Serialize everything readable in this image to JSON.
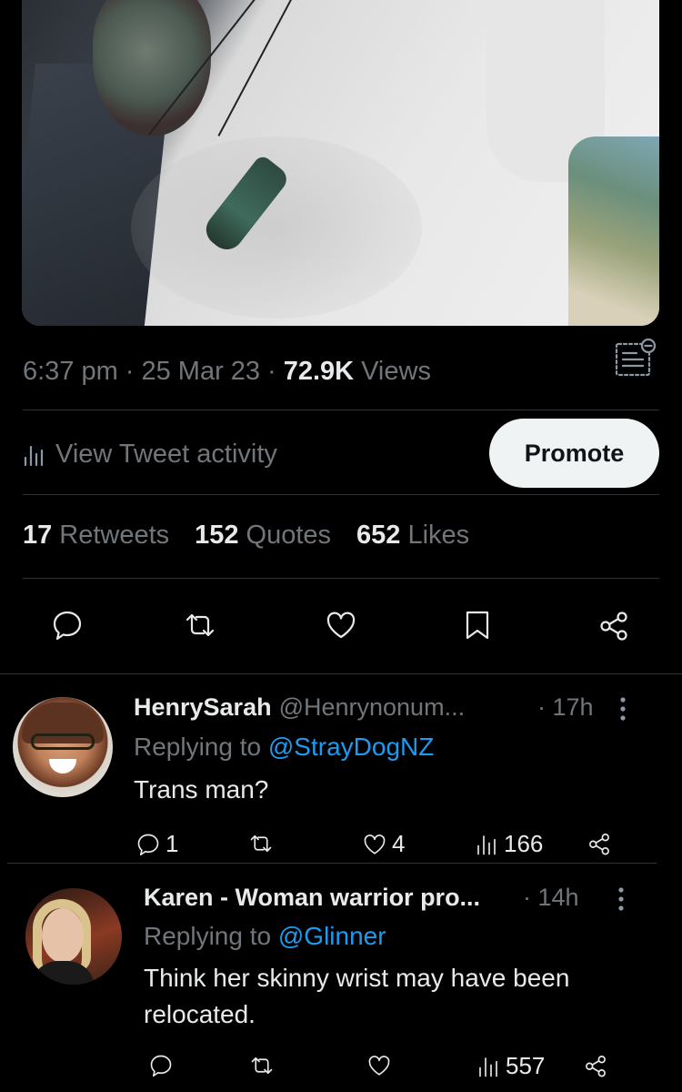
{
  "tweet": {
    "time": "6:37 pm",
    "sep1": "·",
    "date": "25 Mar 23",
    "sep2": "·",
    "views_count": "72.9K",
    "views_label": "Views",
    "activity_label": "View Tweet activity",
    "promote_label": "Promote",
    "stats": {
      "retweets_count": "17",
      "retweets_label": "Retweets",
      "quotes_count": "152",
      "quotes_label": "Quotes",
      "likes_count": "652",
      "likes_label": "Likes"
    },
    "icons": [
      "reply-icon",
      "retweet-icon",
      "like-icon",
      "bookmark-icon",
      "share-icon"
    ]
  },
  "replies": [
    {
      "name": "HenrySarah",
      "handle": "@Henrynonum...",
      "time": "· 17h",
      "replying_prefix": "Replying to",
      "replying_to": "@StrayDogNZ",
      "text": "Trans man?",
      "reply_count": "1",
      "retweet_count": "",
      "like_count": "4",
      "view_count": "166"
    },
    {
      "name": "Karen - Woman warrior pro...",
      "handle": "",
      "time": "· 14h",
      "replying_prefix": "Replying to",
      "replying_to": "@Glinner",
      "text_line1": "Think her skinny wrist may have been",
      "text_line2": "relocated.",
      "reply_count": "",
      "retweet_count": "",
      "like_count": "",
      "view_count": "557"
    }
  ],
  "colors": {
    "background": "#000000",
    "text_primary": "#e7e9ea",
    "text_secondary": "#71767b",
    "link": "#1d9bf0",
    "divider": "#2f3336",
    "promote_bg": "#eff3f4"
  }
}
